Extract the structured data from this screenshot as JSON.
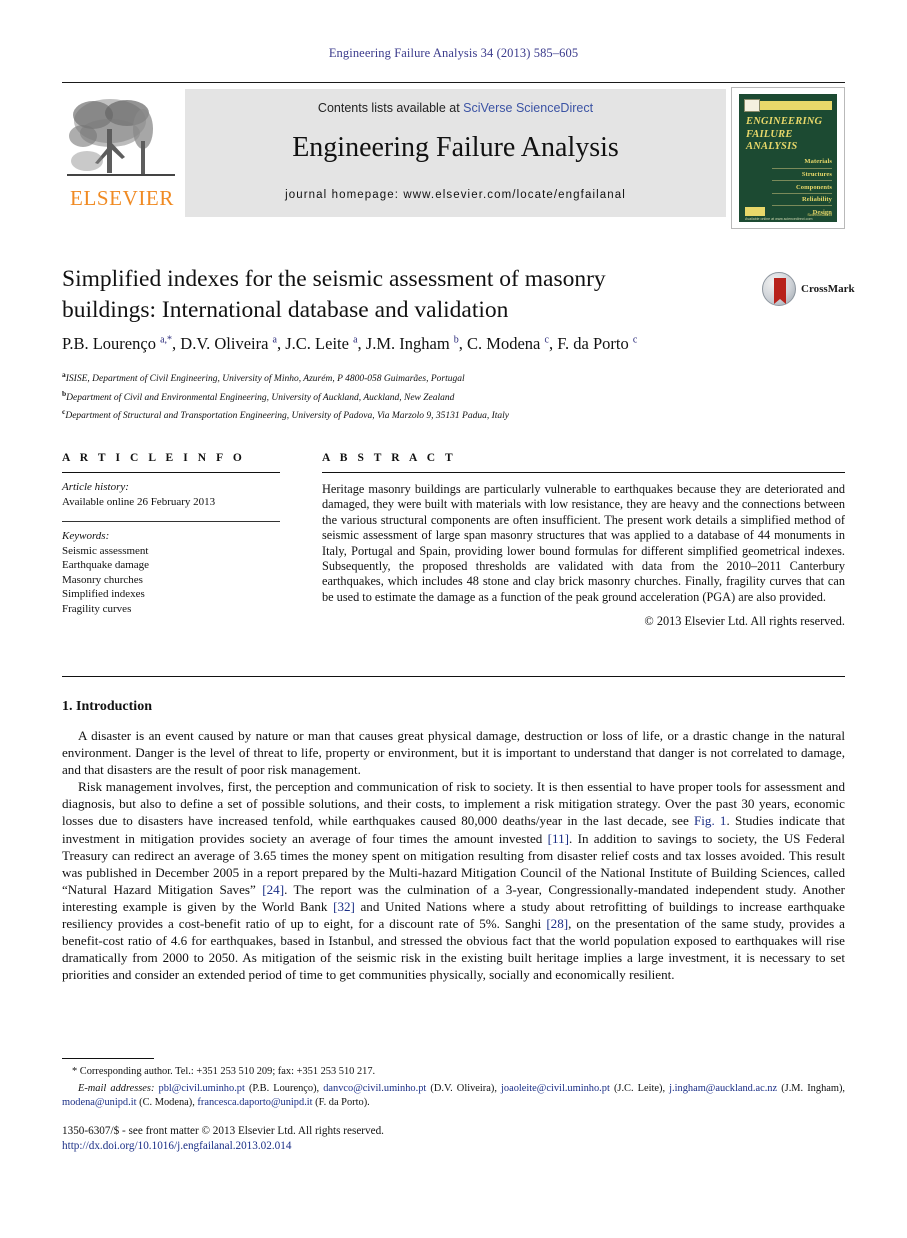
{
  "running_head": "Engineering Failure Analysis 34 (2013) 585–605",
  "journal_header": {
    "contents_prefix": "Contents lists available at ",
    "contents_link": "SciVerse ScienceDirect",
    "journal_title": "Engineering Failure Analysis",
    "homepage": "journal homepage: www.elsevier.com/locate/engfailanal",
    "publisher_logo_text": "ELSEVIER",
    "cover": {
      "title_lines": [
        "ENGINEERING",
        "FAILURE",
        "ANALYSIS"
      ],
      "topics": [
        "Materials",
        "Structures",
        "Components",
        "Reliability",
        "Design"
      ],
      "footer_note": "Available online at www.sciencedirect.com",
      "sub_note": "ScienceDirect"
    }
  },
  "article": {
    "title": "Simplified indexes for the seismic assessment of masonry buildings: International database and validation",
    "crossmark_label": "CrossMark",
    "authors_html": "P.B. Lourenço <sup>a,*</sup>, D.V. Oliveira <sup>a</sup>, J.C. Leite <sup>a</sup>, J.M. Ingham <sup>b</sup>, C. Modena <sup>c</sup>, F. da Porto <sup>c</sup>",
    "affiliations": [
      {
        "marker": "a",
        "text": "ISISE, Department of Civil Engineering, University of Minho, Azurém, P 4800-058 Guimarães, Portugal"
      },
      {
        "marker": "b",
        "text": "Department of Civil and Environmental Engineering, University of Auckland, Auckland, New Zealand"
      },
      {
        "marker": "c",
        "text": "Department of Structural and Transportation Engineering, University of Padova, Via Marzolo 9, 35131 Padua, Italy"
      }
    ]
  },
  "article_info": {
    "heading": "A R T I C L E   I N F O",
    "history_label": "Article history:",
    "history_value": "Available online 26 February 2013",
    "keywords_label": "Keywords:",
    "keywords": [
      "Seismic assessment",
      "Earthquake damage",
      "Masonry churches",
      "Simplified indexes",
      "Fragility curves"
    ]
  },
  "abstract": {
    "heading": "A B S T R A C T",
    "text": "Heritage masonry buildings are particularly vulnerable to earthquakes because they are deteriorated and damaged, they were built with materials with low resistance, they are heavy and the connections between the various structural components are often insufficient. The present work details a simplified method of seismic assessment of large span masonry structures that was applied to a database of 44 monuments in Italy, Portugal and Spain, providing lower bound formulas for different simplified geometrical indexes. Subsequently, the proposed thresholds are validated with data from the 2010–2011 Canterbury earthquakes, which includes 48 stone and clay brick masonry churches. Finally, fragility curves that can be used to estimate the damage as a function of the peak ground acceleration (PGA) are also provided.",
    "copyright": "© 2013 Elsevier Ltd. All rights reserved."
  },
  "section": {
    "heading": "1. Introduction",
    "paragraph_1": "A disaster is an event caused by nature or man that causes great physical damage, destruction or loss of life, or a drastic change in the natural environment. Danger is the level of threat to life, property or environment, but it is important to understand that danger is not correlated to damage, and that disasters are the result of poor risk management.",
    "paragraph_2_html": "Risk management involves, first, the perception and communication of risk to society. It is then essential to have proper tools for assessment and diagnosis, but also to define a set of possible solutions, and their costs, to implement a risk mitigation strategy. Over the past 30 years, economic losses due to disasters have increased tenfold, while earthquakes caused 80,000 deaths/year in the last decade, see <span class=\"lnk\">Fig. 1</span>. Studies indicate that investment in mitigation provides society an average of four times the amount invested <span class=\"lnk\">[11]</span>. In addition to savings to society, the US Federal Treasury can redirect an average of 3.65 times the money spent on mitigation resulting from disaster relief costs and tax losses avoided. This result was published in December 2005 in a report prepared by the Multi-hazard Mitigation Council of the National Institute of Building Sciences, called &ldquo;Natural Hazard Mitigation Saves&rdquo; <span class=\"lnk\">[24]</span>. The report was the culmination of a 3-year, Congressionally-mandated independent study. Another interesting example is given by the World Bank <span class=\"lnk\">[32]</span> and United Nations where a study about retrofitting of buildings to increase earthquake resiliency provides a cost-benefit ratio of up to eight, for a discount rate of 5%. Sanghi <span class=\"lnk\">[28]</span>, on the presentation of the same study, provides a benefit-cost ratio of 4.6 for earthquakes, based in Istanbul, and stressed the obvious fact that the world population exposed to earthquakes will rise dramatically from 2000 to 2050. As mitigation of the seismic risk in the existing built heritage implies a large investment, it is necessary to set priorities and consider an extended period of time to get communities physically, socially and economically resilient."
  },
  "footnotes": {
    "corresponding": "* Corresponding author. Tel.: +351 253 510 209; fax: +351 253 510 217.",
    "email_label": "E-mail addresses:",
    "emails_html": "<span class=\"lnk\">pbl@civil.uminho.pt</span> (P.B. Lourenço), <span class=\"lnk\">danvco@civil.uminho.pt</span> (D.V. Oliveira), <span class=\"lnk\">joaoleite@civil.uminho.pt</span> (J.C. Leite), <span class=\"lnk\">j.ingham@auckland.ac.nz</span> (J.M. Ingham), <span class=\"lnk\">modena@unipd.it</span> (C. Modena), <span class=\"lnk\">francesca.daporto@unipd.it</span> (F. da Porto)."
  },
  "imprint": {
    "line1": "1350-6307/$ - see front matter © 2013 Elsevier Ltd. All rights reserved.",
    "doi": "http://dx.doi.org/10.1016/j.engfailanal.2013.02.014"
  }
}
